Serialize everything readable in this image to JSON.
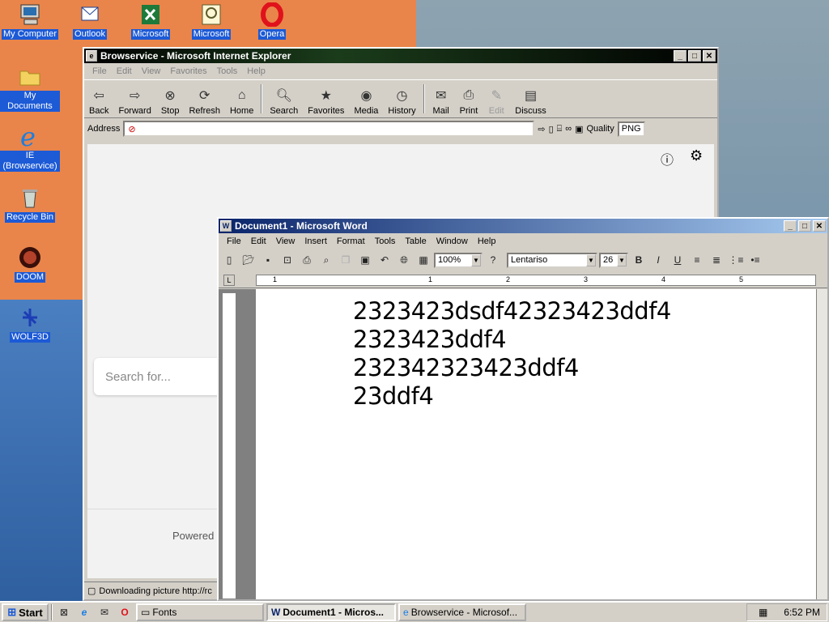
{
  "desktop": {
    "icons": [
      {
        "label": "My Computer"
      },
      {
        "label": "Outlook"
      },
      {
        "label": "Microsoft"
      },
      {
        "label": "Microsoft"
      },
      {
        "label": "Opera"
      },
      {
        "label": "My Documents"
      },
      {
        "label": "IE (Browservice)"
      },
      {
        "label": "Recycle Bin"
      },
      {
        "label": "DOOM"
      },
      {
        "label": "WOLF3D"
      }
    ]
  },
  "ie": {
    "title": "Browservice - Microsoft Internet Explorer",
    "menu": [
      "File",
      "Edit",
      "View",
      "Favorites",
      "Tools",
      "Help"
    ],
    "toolbar": [
      "Back",
      "Forward",
      "Stop",
      "Refresh",
      "Home",
      "Search",
      "Favorites",
      "Media",
      "History",
      "Mail",
      "Print",
      "Edit",
      "Discuss"
    ],
    "address_label": "Address",
    "address_value": "",
    "quality_label": "Quality",
    "quality_value": "PNG",
    "search_placeholder": "Search for...",
    "powered_text": "Powered",
    "status_text": "Downloading picture http://rc"
  },
  "word": {
    "title": "Document1 - Microsoft Word",
    "menu": [
      "File",
      "Edit",
      "View",
      "Insert",
      "Format",
      "Tools",
      "Table",
      "Window",
      "Help"
    ],
    "zoom": "100%",
    "font": "Lentariso",
    "font_size": "26",
    "ruler_numbers": [
      "1",
      "1",
      "2",
      "3",
      "4",
      "5"
    ],
    "lines": [
      "2323423dsdf42323423ddf4",
      "2323423ddf4",
      "232342323423ddf4",
      "23ddf4"
    ]
  },
  "taskbar": {
    "start": "Start",
    "items": [
      "Fonts",
      "Document1 - Micros...",
      "Browservice - Microsof..."
    ],
    "clock": "6:52 PM"
  },
  "colors": {
    "ie_title": "#000000",
    "word_title": "#0a246a",
    "desktop_blue": "#1c5ad6"
  }
}
